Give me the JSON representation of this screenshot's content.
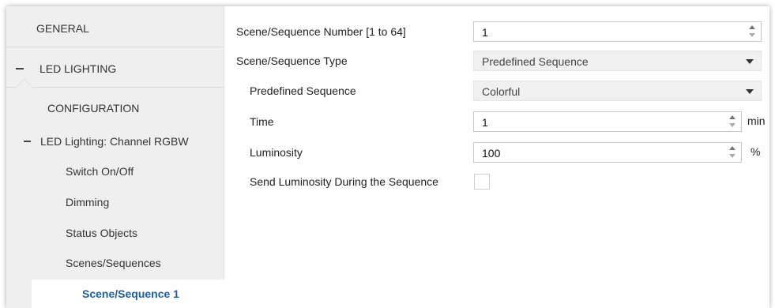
{
  "sidebar": {
    "items": [
      {
        "label": "GENERAL"
      },
      {
        "label": "LED LIGHTING"
      },
      {
        "label": "CONFIGURATION"
      },
      {
        "label": "LED Lighting: Channel RGBW"
      },
      {
        "label": "Switch On/Off"
      },
      {
        "label": "Dimming"
      },
      {
        "label": "Status Objects"
      },
      {
        "label": "Scenes/Sequences"
      },
      {
        "label": "Scene/Sequence 1"
      }
    ]
  },
  "form": {
    "scene_number": {
      "label": "Scene/Sequence Number [1 to 64]",
      "value": "1"
    },
    "scene_type": {
      "label": "Scene/Sequence Type",
      "value": "Predefined Sequence"
    },
    "predefined_sequence": {
      "label": "Predefined Sequence",
      "value": "Colorful"
    },
    "time": {
      "label": "Time",
      "value": "1",
      "unit": "min"
    },
    "luminosity": {
      "label": "Luminosity",
      "value": "100",
      "unit": "%"
    },
    "send_luminosity": {
      "label": "Send Luminosity During the Sequence",
      "checked": false
    }
  },
  "colors": {
    "selected_text": "#1f5f99",
    "sidebar_bg": "#efefef"
  }
}
